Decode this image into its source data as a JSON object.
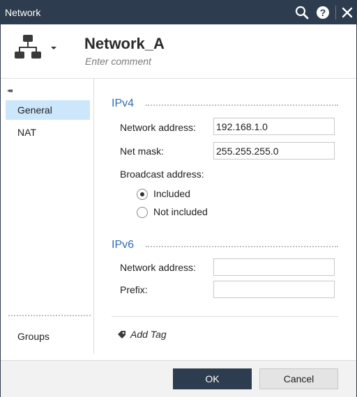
{
  "window": {
    "title": "Network"
  },
  "titlebar": {
    "icons": [
      "search-icon",
      "help-icon",
      "close-icon"
    ]
  },
  "header": {
    "object_icon": "network-topology-icon",
    "name": "Network_A",
    "comment_placeholder": "Enter comment"
  },
  "sidebar": {
    "collapse_icon": "double-chevron-left-icon",
    "items": [
      {
        "label": "General",
        "selected": true
      },
      {
        "label": "NAT",
        "selected": false
      }
    ],
    "groups_label": "Groups"
  },
  "ipv4": {
    "title": "IPv4",
    "network_address_label": "Network address:",
    "network_address_value": "192.168.1.0",
    "net_mask_label": "Net mask:",
    "net_mask_value": "255.255.255.0",
    "broadcast_label": "Broadcast address:",
    "broadcast_options": [
      {
        "label": "Included",
        "checked": true
      },
      {
        "label": "Not included",
        "checked": false
      }
    ]
  },
  "ipv6": {
    "title": "IPv6",
    "network_address_label": "Network address:",
    "network_address_value": "",
    "prefix_label": "Prefix:",
    "prefix_value": ""
  },
  "tags": {
    "add_label": "Add Tag",
    "icon": "tag-icon"
  },
  "footer": {
    "ok_label": "OK",
    "cancel_label": "Cancel"
  },
  "colors": {
    "titlebar": "#2d3c4e",
    "accent": "#2f6db5",
    "selected_nav": "#cce6fb",
    "primary_button": "#2d3c4e"
  }
}
